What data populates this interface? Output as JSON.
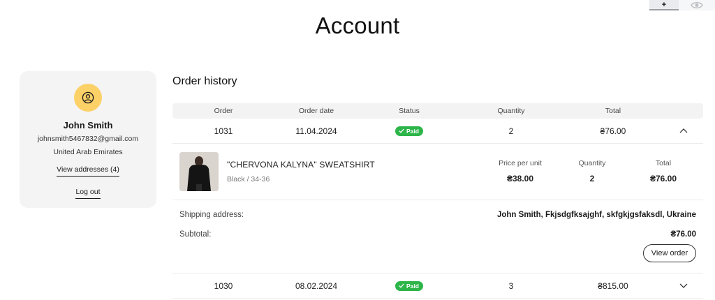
{
  "page": {
    "title": "Account"
  },
  "tools": {
    "add_label": "+"
  },
  "profile": {
    "name": "John Smith",
    "email": "johnsmith5467832@gmail.com",
    "country": "United Arab Emirates",
    "addresses_link": "View addresses (4)",
    "logout_link": "Log out",
    "avatar_color": "#fcd168"
  },
  "orders": {
    "title": "Order history",
    "columns": [
      "Order",
      "Order date",
      "Status",
      "Quantity",
      "Total"
    ],
    "rows": [
      {
        "order": "1031",
        "date": "11.04.2024",
        "status": "Paid",
        "quantity": "2",
        "total": "₴76.00",
        "expanded": true
      },
      {
        "order": "1030",
        "date": "08.02.2024",
        "status": "Paid",
        "quantity": "3",
        "total": "₴815.00",
        "expanded": false
      }
    ],
    "detail": {
      "item_name": "\"CHERVONA KALYNA\" SWEATSHIRT",
      "item_variant": "Black / 34-36",
      "price_label": "Price per unit",
      "price_value": "₴38.00",
      "qty_label": "Quantity",
      "qty_value": "2",
      "total_label": "Total",
      "total_value": "₴76.00",
      "shipping_label": "Shipping address:",
      "shipping_value": "John Smith, Fkjsdgfksajghf, skfgkjgsfaksdl, Ukraine",
      "subtotal_label": "Subtotal:",
      "subtotal_value": "₴76.00",
      "view_order": "View order"
    }
  },
  "colors": {
    "status_paid": "#2db54a",
    "card_bg": "#f4f4f4",
    "header_bg": "#f3f3f3"
  }
}
